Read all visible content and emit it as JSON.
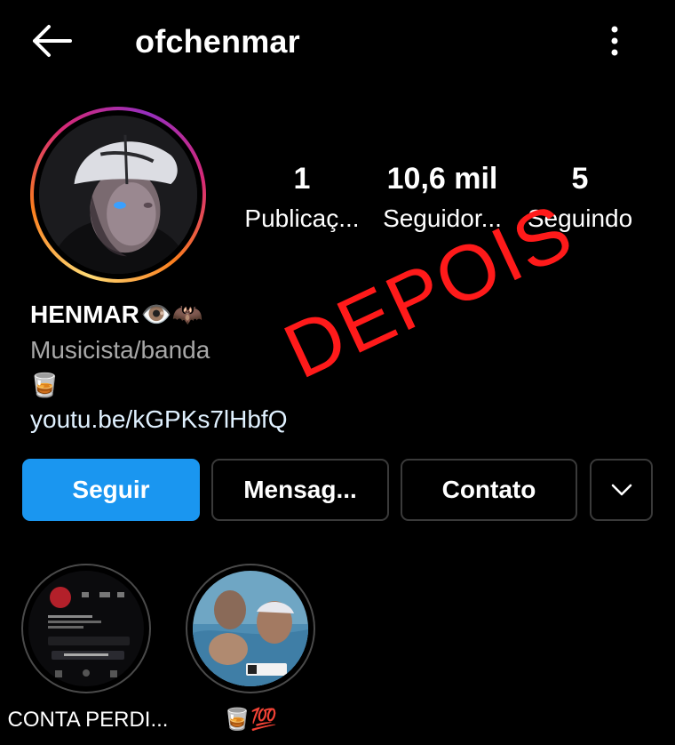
{
  "header": {
    "username": "ofchenmar",
    "back_icon": "back-arrow-icon",
    "more_icon": "more-vertical-icon"
  },
  "stats": {
    "posts": {
      "value": "1",
      "label": "Publicaç..."
    },
    "followers": {
      "value": "10,6 mil",
      "label": "Seguidor..."
    },
    "following": {
      "value": "5",
      "label": "Seguindo"
    }
  },
  "bio": {
    "name": "HENMAR",
    "name_emojis": "👁️🦇",
    "category": "Musicista/banda",
    "emoji_line": "🥃",
    "link": "youtu.be/kGPKs7lHbfQ"
  },
  "overlay_text": "DEPOIS",
  "actions": {
    "follow": "Seguir",
    "message": "Mensag...",
    "contact": "Contato",
    "dropdown_icon": "chevron-down-icon"
  },
  "highlights": [
    {
      "label": "CONTA PERDI..."
    },
    {
      "label": "🥃💯"
    }
  ],
  "colors": {
    "background": "#000000",
    "follow_button": "#1a96f0",
    "overlay": "#ff1a1a",
    "secondary_text": "#a8a8a8"
  }
}
